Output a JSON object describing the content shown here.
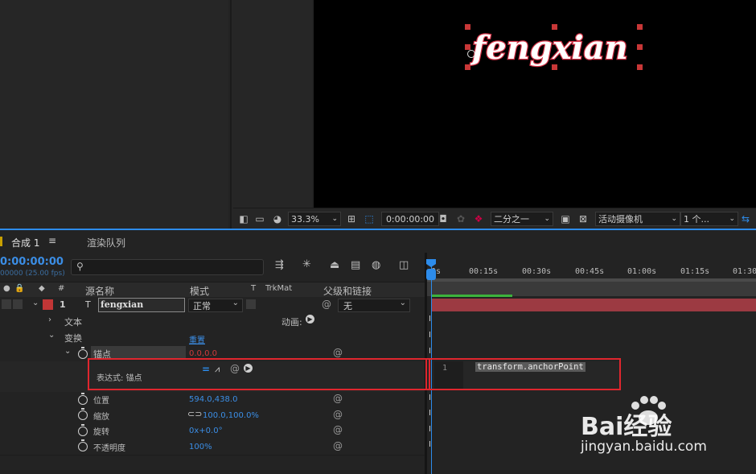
{
  "viewer": {
    "text": "fengxian",
    "zoom": "33.3%",
    "timecode": "0:00:00:00",
    "resolution": "二分之一",
    "camera": "活动摄像机",
    "views": "1 个..."
  },
  "tabs": {
    "comp": "合成 1",
    "render": "渲染队列"
  },
  "timeline": {
    "current_time": "0:00:00:00",
    "fps": "00000 (25.00 fps)",
    "search_icon": "search-icon",
    "columns": {
      "num": "#",
      "source": "源名称",
      "mode": "模式",
      "t": "T",
      "trkmat": "TrkMat",
      "parent": "父级和链接"
    },
    "ruler": [
      "0s",
      "00:15s",
      "00:30s",
      "00:45s",
      "01:00s",
      "01:15s",
      "01:30"
    ],
    "layer": {
      "index": "1",
      "type": "T",
      "name": "fengxian",
      "mode": "正常",
      "parent": "无"
    },
    "props": {
      "text": "文本",
      "animate": "动画:",
      "transform": "变换",
      "reset": "重置",
      "anchor": "锚点",
      "anchor_val": "0.0,0.0",
      "expr_label": "表达式: 锚点",
      "expr_line": "1",
      "expr_code": "transform.anchorPoint",
      "position": "位置",
      "position_val": "594.0,438.0",
      "scale": "缩放",
      "scale_val": "100.0,100.0%",
      "rotation": "旋转",
      "rotation_val": "0x+0.0°",
      "opacity": "不透明度",
      "opacity_val": "100%"
    }
  },
  "watermark": {
    "brand": "Bai经验",
    "url": "jingyan.baidu.com"
  },
  "colors": {
    "accent": "#2d8ceb",
    "layer_bar": "#9c3a42",
    "highlight_box": "#e0262e",
    "value_blue": "#3b8ee6"
  }
}
